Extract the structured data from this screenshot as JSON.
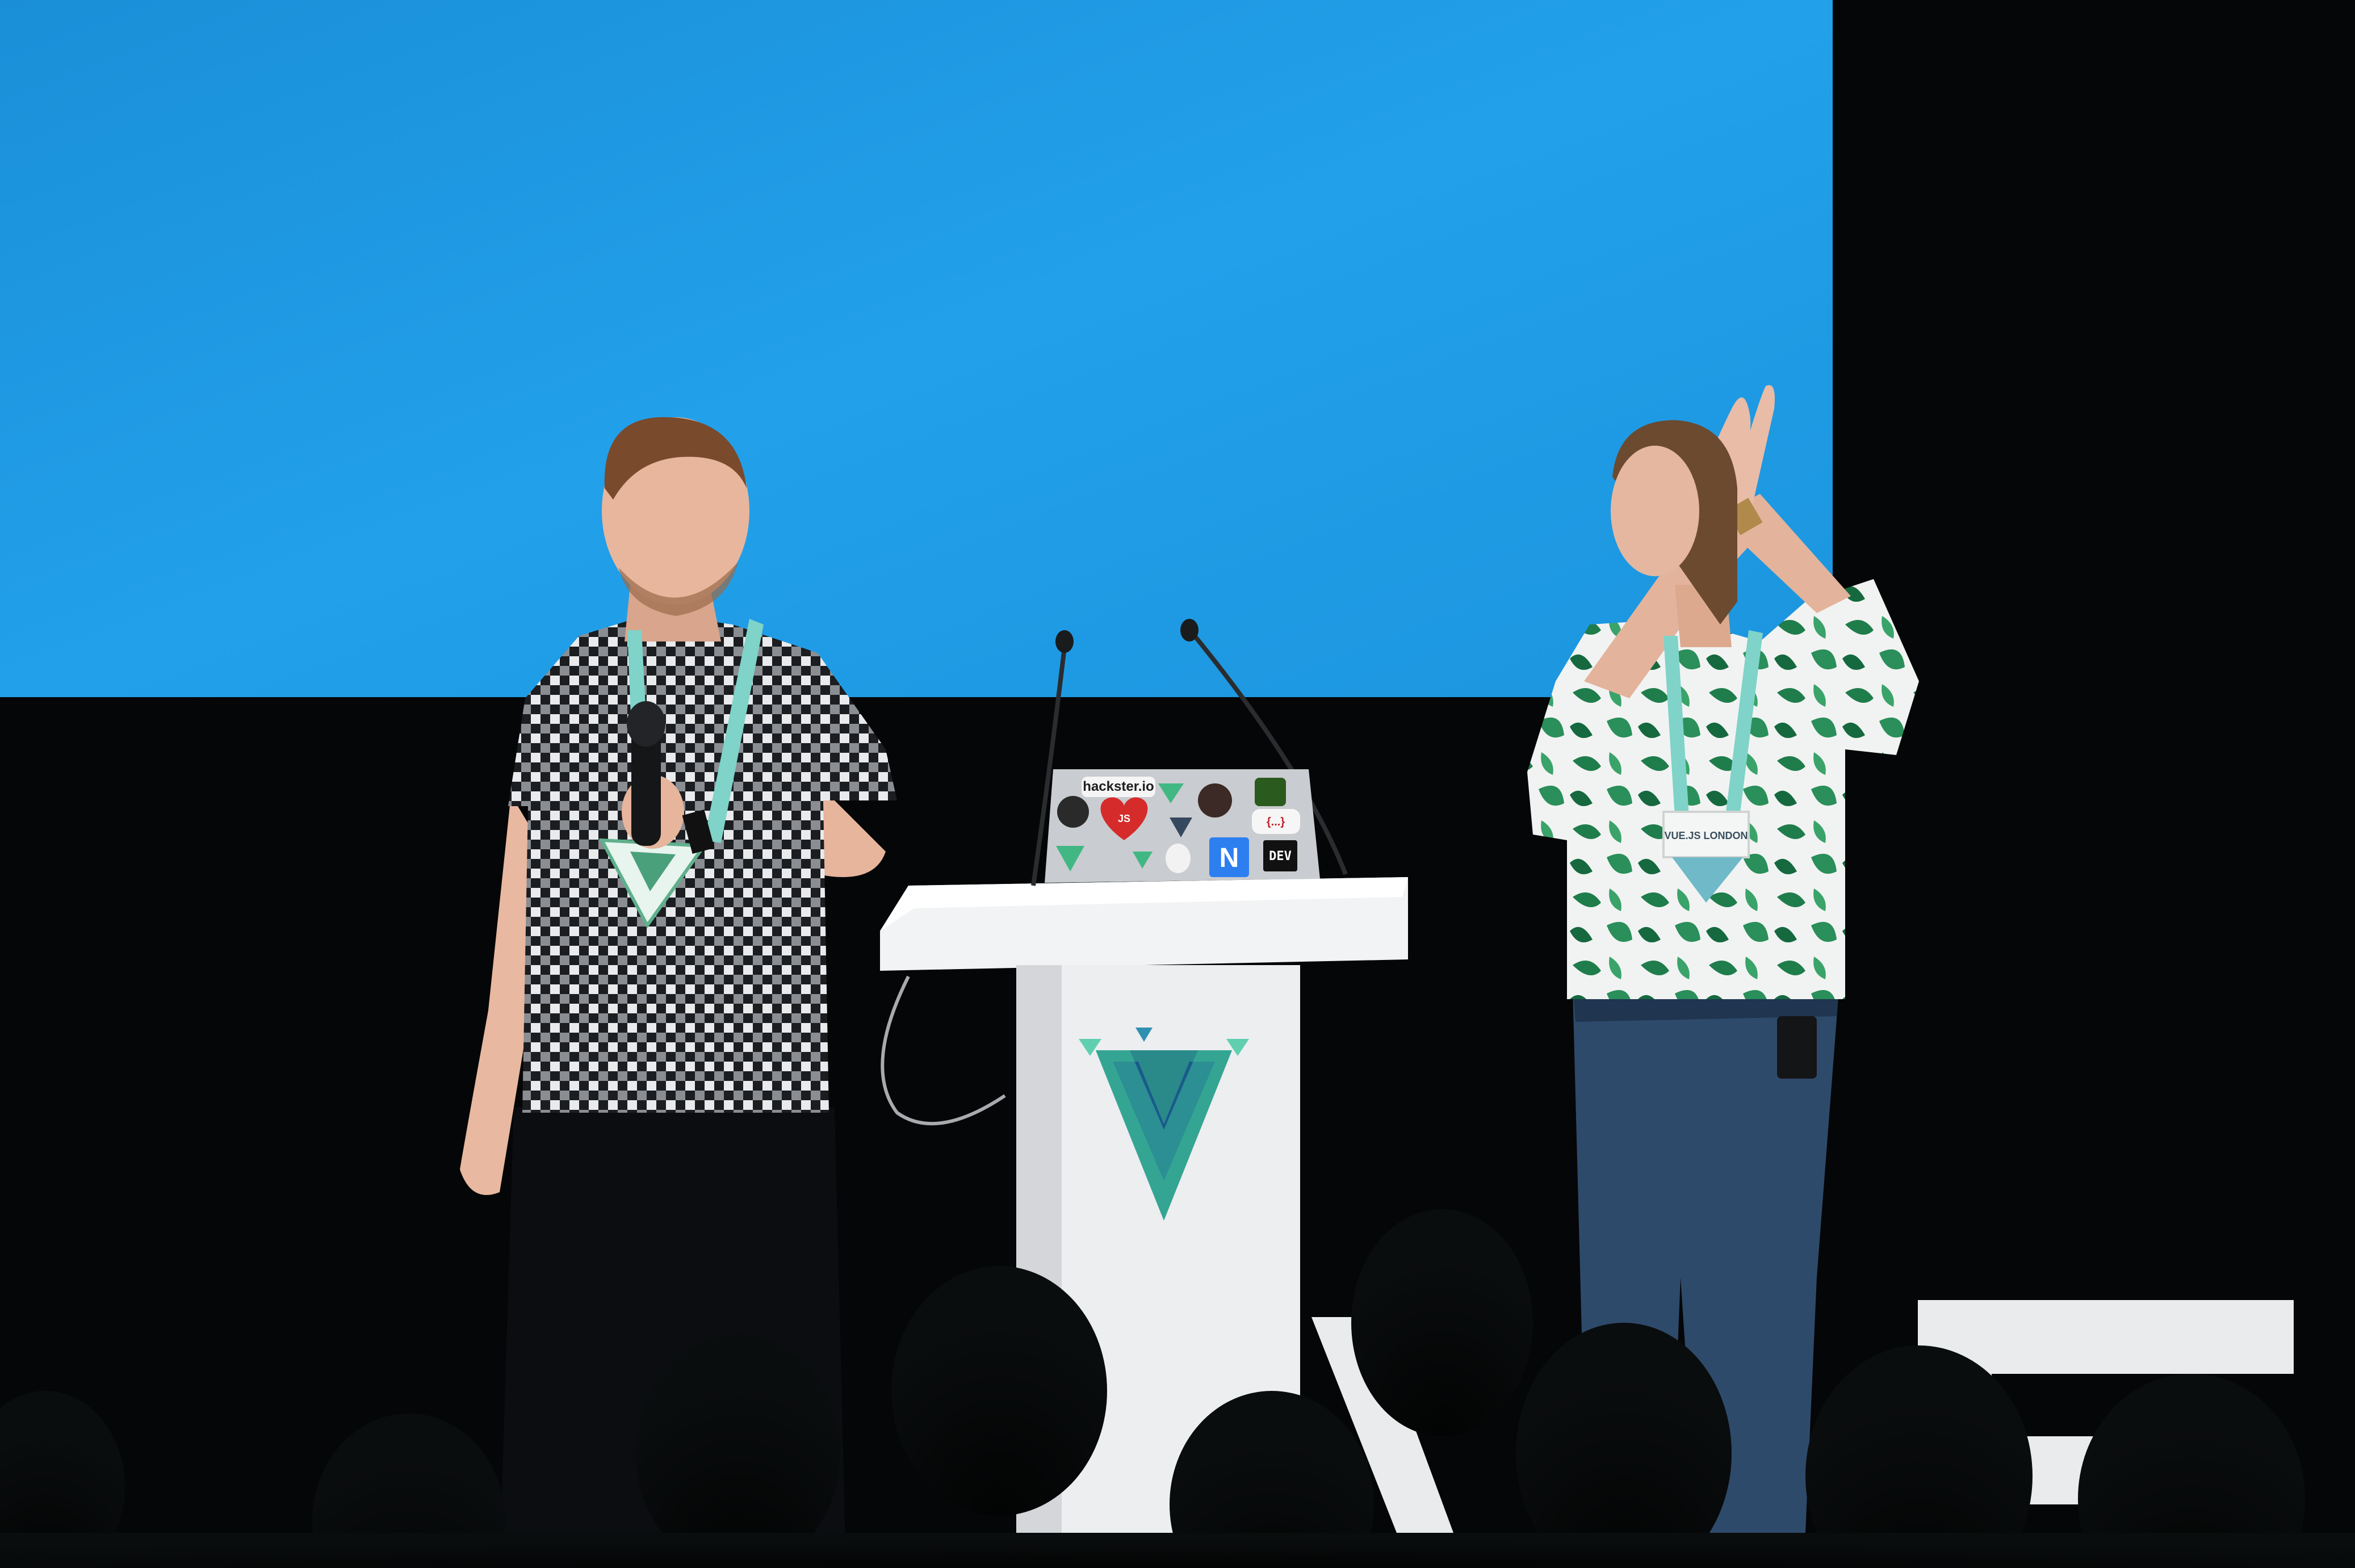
{
  "scene": {
    "colors": {
      "screen": "#1e9be6",
      "backdrop": "#050607",
      "podium": "#eef0f1",
      "laptop": "#c9ccd0",
      "lanyard": "#7fd3c8",
      "shirt_green": "#1e7a4a",
      "jeans": "#2e4a6b"
    }
  },
  "laptop": {
    "stickers": {
      "hackster": "hackster.io",
      "js": "JS",
      "dev": "DEV",
      "n": "N",
      "braces": "{...}"
    }
  },
  "badge": {
    "text": "VUE.JS LONDON"
  }
}
